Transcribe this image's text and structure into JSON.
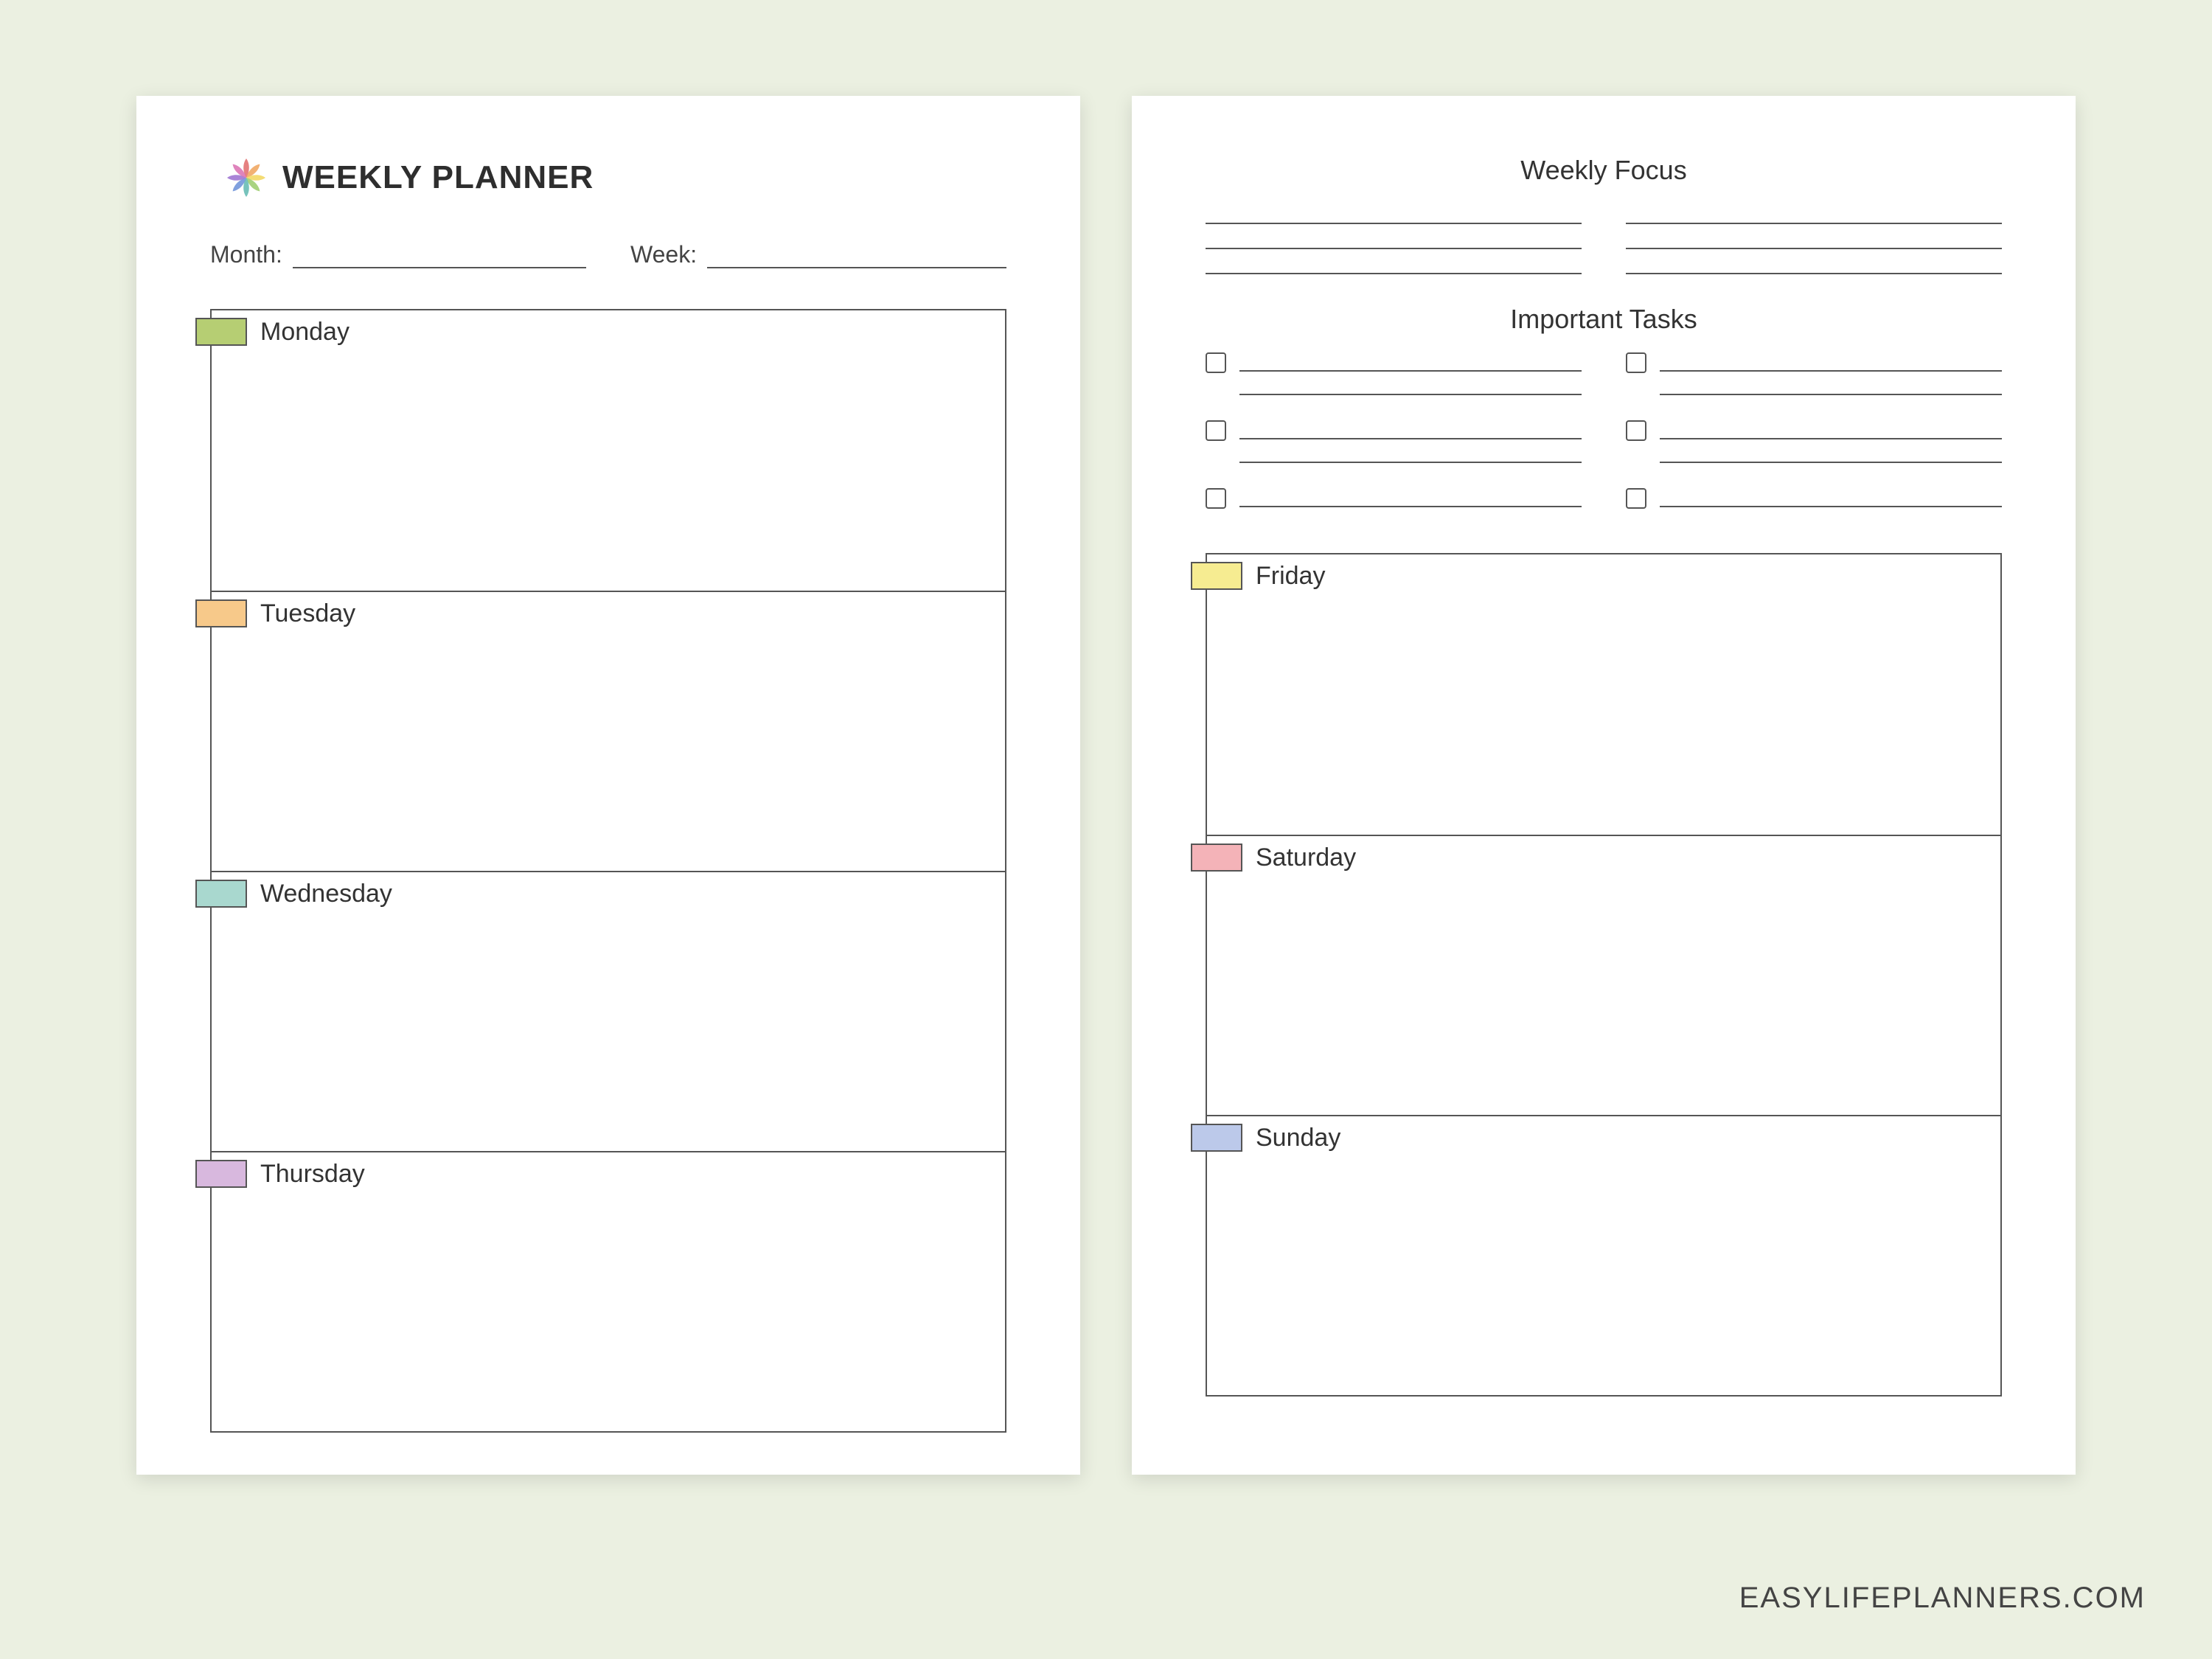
{
  "title": "WEEKLY PLANNER",
  "meta": {
    "month_label": "Month:",
    "week_label": "Week:"
  },
  "left_days": [
    {
      "name": "Monday",
      "color": "#b6ce73"
    },
    {
      "name": "Tuesday",
      "color": "#f7c98a"
    },
    {
      "name": "Wednesday",
      "color": "#a9d8cf"
    },
    {
      "name": "Thursday",
      "color": "#d8b8de"
    }
  ],
  "right": {
    "focus_title": "Weekly Focus",
    "tasks_title": "Important Tasks",
    "days": [
      {
        "name": "Friday",
        "color": "#f6ec91"
      },
      {
        "name": "Saturday",
        "color": "#f4b3b8"
      },
      {
        "name": "Sunday",
        "color": "#bcc9ea"
      }
    ]
  },
  "watermark": "EASYLIFEPLANNERS.COM",
  "logo_colors": [
    "#e06a6a",
    "#f0a35a",
    "#f2d65c",
    "#9acb6b",
    "#5fb8b0",
    "#6a8fd8",
    "#9a6fd0",
    "#d96fb0"
  ]
}
